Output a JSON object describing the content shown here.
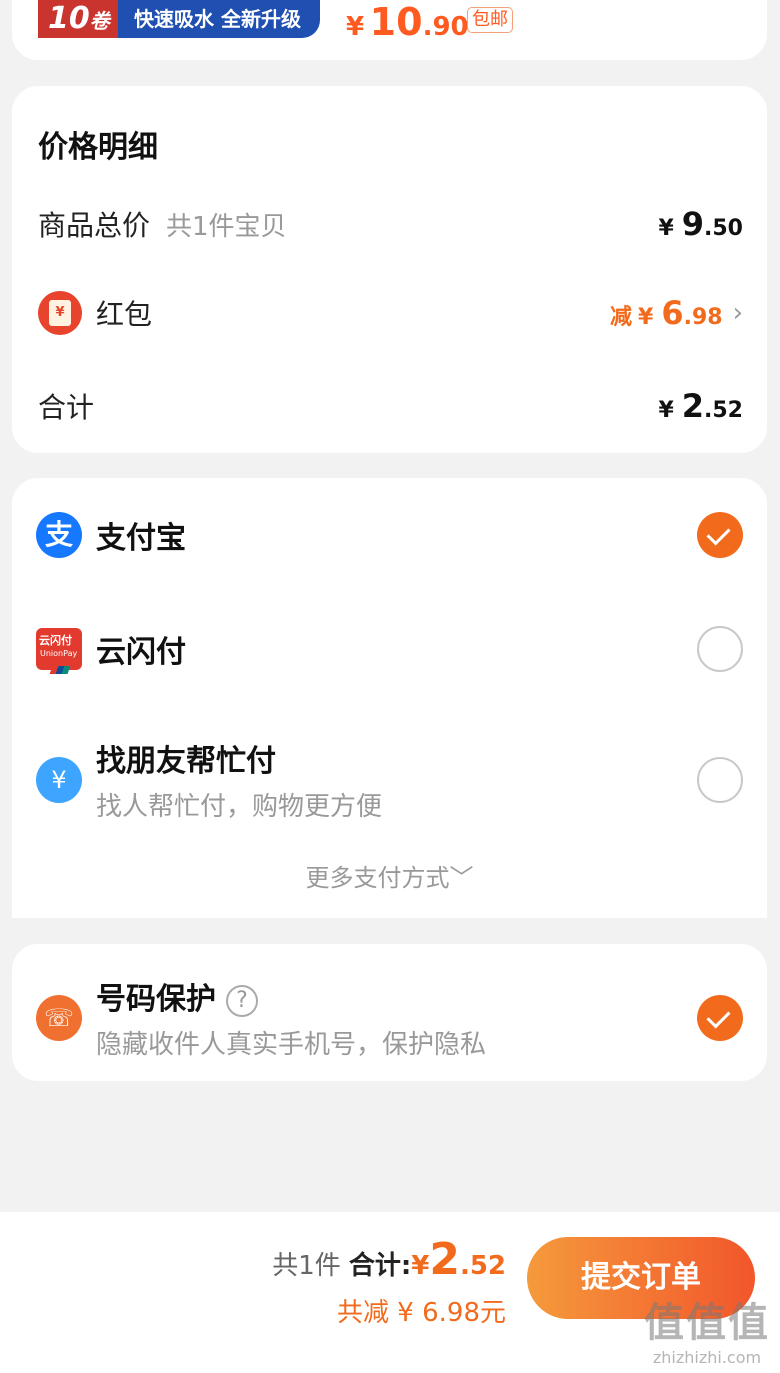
{
  "product": {
    "banner_number": "10",
    "banner_unit": "卷",
    "banner_text": "快速吸水 全新升级",
    "price_yen": "¥",
    "price_int": "10",
    "price_dec": ".90",
    "shipping_badge": "包邮"
  },
  "price_detail": {
    "title": "价格明细",
    "goods_total_label": "商品总价",
    "goods_count": "共1件宝贝",
    "goods_total": {
      "yen": "¥",
      "int": "9",
      "dec": ".50"
    },
    "redpack_icon_text": "¥",
    "redpack_label": "红包",
    "redpack_prefix": "减",
    "redpack_amount": {
      "yen": "¥",
      "int": "6",
      "dec": ".98"
    },
    "total_label": "合计",
    "total_amount": {
      "yen": "¥",
      "int": "2",
      "dec": ".52"
    }
  },
  "payment": {
    "methods": [
      {
        "name": "支付宝",
        "icon": "alipay-icon",
        "icon_text": "支",
        "selected": true
      },
      {
        "name": "云闪付",
        "icon": "unionpay-icon",
        "icon_text": "云闪付",
        "icon_sub": "UnionPay",
        "selected": false
      },
      {
        "name": "找朋友帮忙付",
        "subtitle": "找人帮忙付，购物更方便",
        "icon": "friend-pay-icon",
        "icon_text": "¥",
        "selected": false
      }
    ],
    "more_label": "更多支付方式",
    "more_chevron": "﹀"
  },
  "protection": {
    "title": "号码保护",
    "help_icon_text": "?",
    "subtitle": "隐藏收件人真实手机号，保护隐私",
    "icon": "phone-shield-icon",
    "icon_text": "☏",
    "checked": true
  },
  "bottom_bar": {
    "count": "共1件",
    "total_label": "合计:",
    "total": {
      "yen": "¥",
      "int": "2",
      "dec": ".52"
    },
    "saved": "共减 ¥ 6.98元",
    "submit_label": "提交订单"
  },
  "watermark": {
    "title": "值值值",
    "url": "zhizhizhi.com"
  },
  "colors": {
    "accent": "#f26b1d",
    "alipay": "#1677ff",
    "unionpay": "#e23a2e",
    "background": "#f2f2f2"
  }
}
